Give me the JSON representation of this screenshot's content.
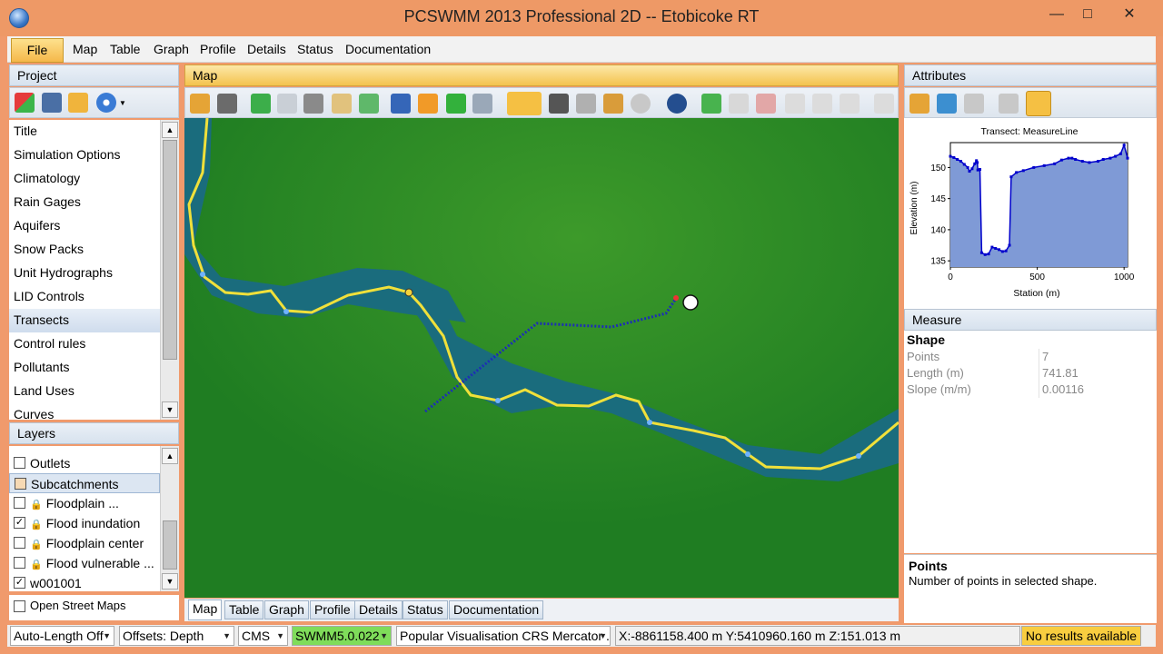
{
  "window": {
    "title": "PCSWMM 2013 Professional 2D -- Etobicoke RT"
  },
  "menu": {
    "file": "File",
    "items": [
      "Map",
      "Table",
      "Graph",
      "Profile",
      "Details",
      "Status",
      "Documentation"
    ]
  },
  "project": {
    "header": "Project",
    "items": [
      "Title",
      "Simulation Options",
      "Climatology",
      "Rain Gages",
      "Aquifers",
      "Snow Packs",
      "Unit Hydrographs",
      "LID Controls",
      "Transects",
      "Control rules",
      "Pollutants",
      "Land Uses",
      "Curves"
    ],
    "selected": "Transects"
  },
  "layers": {
    "header": "Layers",
    "items": [
      {
        "label": "Outlets",
        "checked": false,
        "locked": false
      },
      {
        "label": "Subcatchments",
        "checked": false,
        "locked": false,
        "selected": true
      },
      {
        "label": "Floodplain ...",
        "checked": false,
        "locked": true
      },
      {
        "label": "Flood inundation",
        "checked": true,
        "locked": true
      },
      {
        "label": "Floodplain center",
        "checked": false,
        "locked": true
      },
      {
        "label": "Flood vulnerable ...",
        "checked": false,
        "locked": true
      },
      {
        "label": "w001001",
        "checked": true,
        "locked": false
      }
    ],
    "open_street_maps": "Open Street Maps"
  },
  "map": {
    "header": "Map",
    "tabs": [
      "Map",
      "Table",
      "Graph",
      "Profile",
      "Details",
      "Status",
      "Documentation"
    ],
    "active_tab": "Map"
  },
  "attributes": {
    "header": "Attributes",
    "chart_data": {
      "type": "area",
      "title": "Transect: MeasureLine",
      "xlabel": "Station (m)",
      "ylabel": "Elevation (m)",
      "xlim": [
        0,
        1020
      ],
      "ylim": [
        134,
        154
      ],
      "xticks": [
        0,
        500,
        1000
      ],
      "yticks": [
        135,
        140,
        145,
        150
      ],
      "series": [
        {
          "x": [
            0,
            20,
            40,
            60,
            80,
            100,
            110,
            125,
            140,
            150,
            155,
            158,
            170,
            180,
            200,
            220,
            240,
            260,
            280,
            300,
            320,
            340,
            350,
            380,
            420,
            480,
            540,
            600,
            640,
            680,
            700,
            720,
            760,
            800,
            850,
            880,
            920,
            950,
            980,
            1000,
            1020
          ],
          "y": [
            151.8,
            151.6,
            151.3,
            151.0,
            150.5,
            150.0,
            149.4,
            149.8,
            150.6,
            151.1,
            150.8,
            149.6,
            149.7,
            136.3,
            136.0,
            136.1,
            137.2,
            137.0,
            136.8,
            136.5,
            136.6,
            137.5,
            148.5,
            149.2,
            149.5,
            150.0,
            150.3,
            150.6,
            151.2,
            151.5,
            151.5,
            151.3,
            151.0,
            150.8,
            151.0,
            151.3,
            151.5,
            151.8,
            152.2,
            153.6,
            151.5
          ],
          "color": "#0000cc",
          "fill": "#7f9ad6"
        }
      ]
    }
  },
  "measure": {
    "header": "Measure",
    "section": "Shape",
    "rows": [
      {
        "key": "Points",
        "value": "7"
      },
      {
        "key": "Length (m)",
        "value": "741.81"
      },
      {
        "key": "Slope (m/m)",
        "value": "0.00116"
      }
    ]
  },
  "info": {
    "title": "Points",
    "text": "Number of points in selected shape."
  },
  "status": {
    "auto_length": "Auto-Length Off",
    "offsets": "Offsets: Depth",
    "units": "CMS",
    "engine": "SWMM5.0.022",
    "crs": "Popular Visualisation CRS Mercator ...",
    "coords": "X:-8861158.400 m Y:5410960.160 m Z:151.013 m",
    "results": "No results available"
  },
  "colors": {
    "accent_orange": "#f5c043",
    "map_green": "#1f7d22",
    "river_blue": "#1a6c7d",
    "engine_green": "#7fdc5a"
  }
}
